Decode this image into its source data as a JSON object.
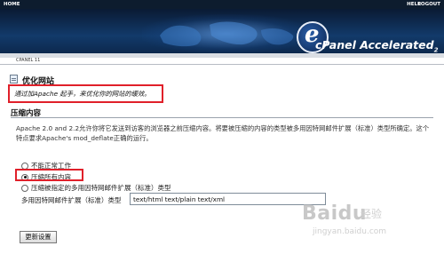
{
  "topbar": {
    "home": "HOME",
    "help": "HELP",
    "logout": "LOGOUT"
  },
  "banner": {
    "logo_letter": "e",
    "brand": "cPanel Accelerated",
    "brand_version": "2"
  },
  "breadcrumb": "CPANEL 11",
  "page": {
    "title": "优化网站",
    "description": "通过加Apache 起手，来优化你的网站的缓效。"
  },
  "section": {
    "title": "压缩内容",
    "paragraph": "Apache 2.0 and 2.2允许你将它发送到访客的浏览器之前压缩内容。将要被压缩的内容的类型被多用因特网邮件扩展（标准）类型所确定。这个特点要求Apache's mod_deflate正确的运行。"
  },
  "options": [
    {
      "label": "不能正常工作",
      "selected": false
    },
    {
      "label": "压缩所有内容",
      "selected": true
    },
    {
      "label": "压缩被指定的多用因特网邮件扩展（标准）类型",
      "selected": false
    }
  ],
  "mime": {
    "label": "多用因特网邮件扩展（标准）类型",
    "value": "text/html text/plain text/xml"
  },
  "update_button": "更新设置",
  "watermark": {
    "main": "Baidu",
    "sub": "经验",
    "url": "jingyan.baidu.com"
  },
  "colors": {
    "banner_dark": "#0a1a33",
    "highlight_border": "#e0202a"
  }
}
